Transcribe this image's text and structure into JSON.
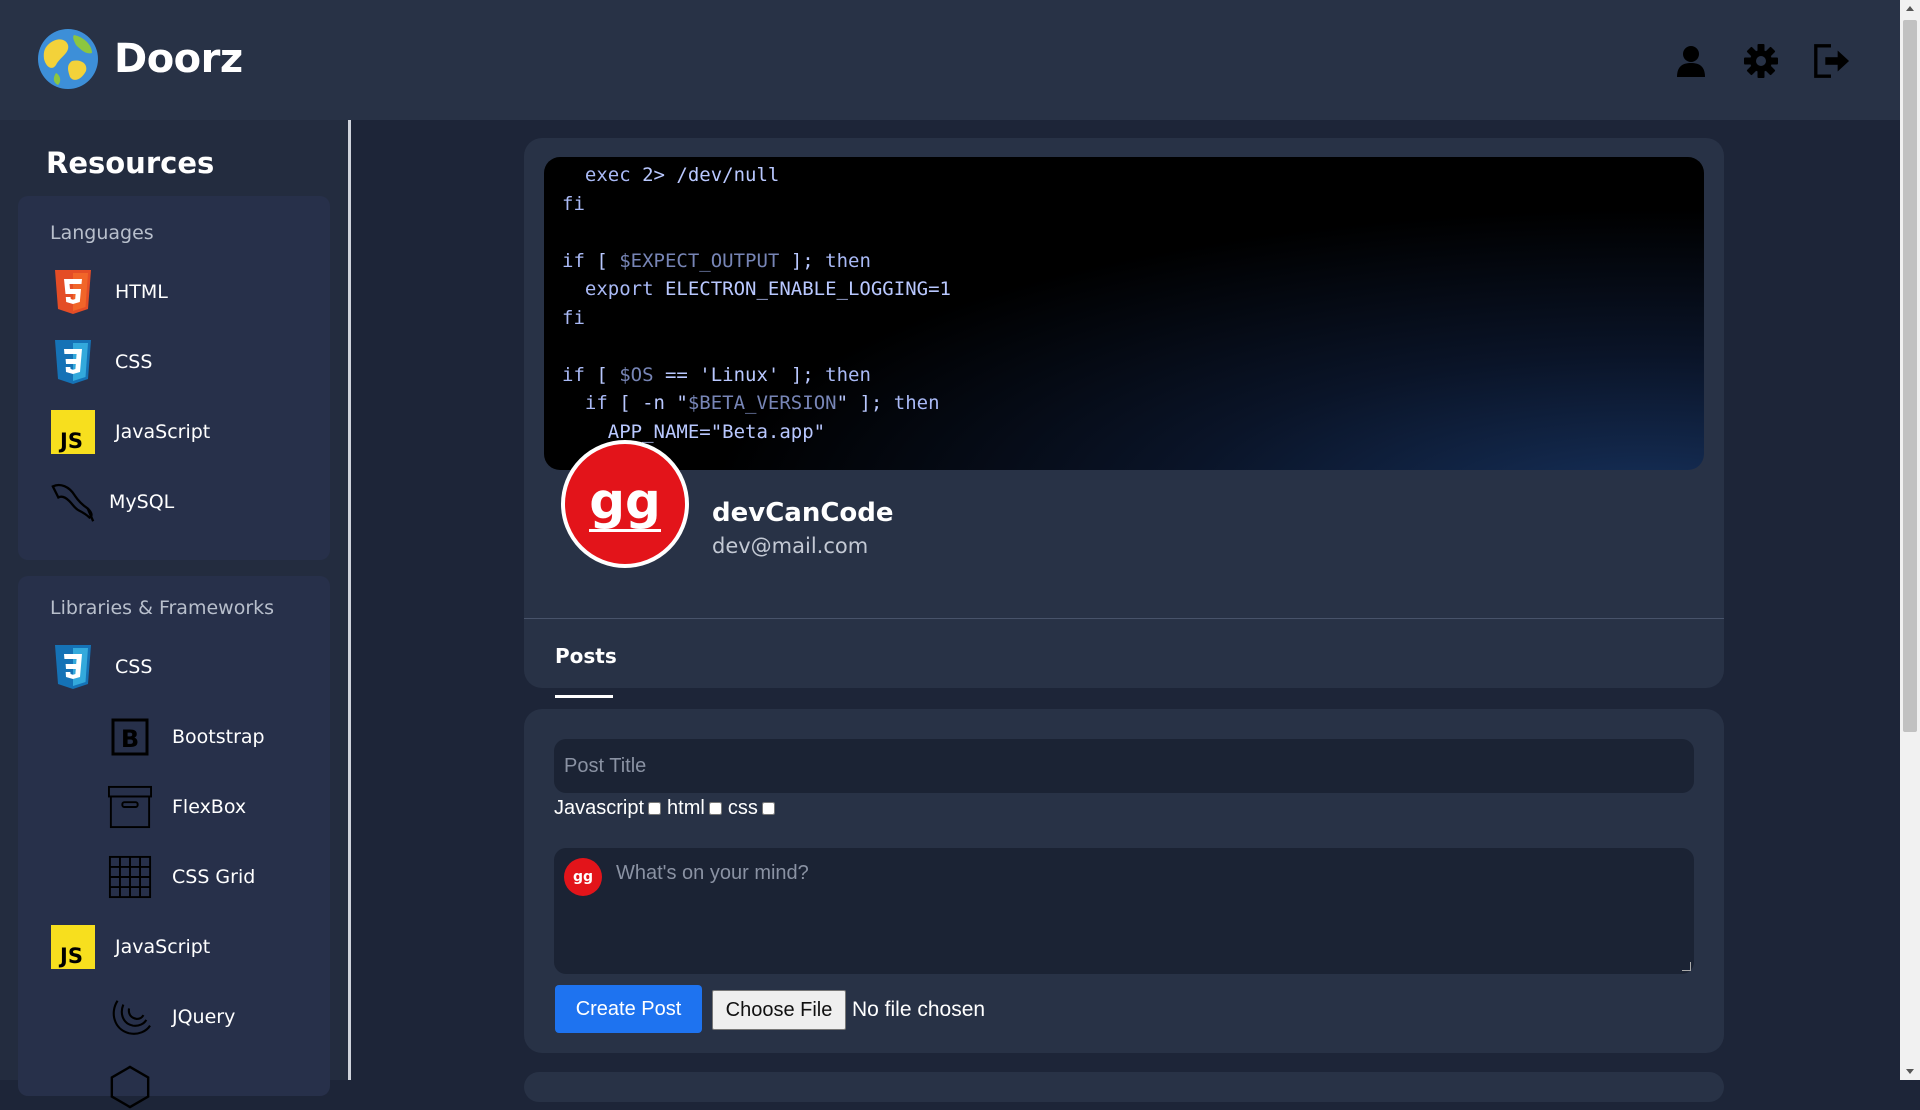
{
  "app": {
    "name": "Doorz"
  },
  "header": {
    "icons": [
      "user-icon",
      "gear-icon",
      "sign-out-icon"
    ]
  },
  "sidebar": {
    "title": "Resources",
    "sections": [
      {
        "label": "Languages",
        "items": [
          {
            "label": "HTML",
            "icon": "html5-icon"
          },
          {
            "label": "CSS",
            "icon": "css3-icon"
          },
          {
            "label": "JavaScript",
            "icon": "js-icon"
          },
          {
            "label": "MySQL",
            "icon": "mysql-dolphin-icon"
          }
        ]
      },
      {
        "label": "Libraries & Frameworks",
        "items": [
          {
            "label": "CSS",
            "icon": "css3-icon"
          },
          {
            "label": "Bootstrap",
            "icon": "bootstrap-icon"
          },
          {
            "label": "FlexBox",
            "icon": "archive-box-icon"
          },
          {
            "label": "CSS Grid",
            "icon": "grid-icon"
          },
          {
            "label": "JavaScript",
            "icon": "js-icon"
          },
          {
            "label": "JQuery",
            "icon": "jquery-icon"
          }
        ]
      }
    ]
  },
  "profile": {
    "banner_code": [
      "  exec 2> /dev/null",
      "fi",
      "",
      "if [ $EXPECT_OUTPUT ]; then",
      "  export ELECTRON_ENABLE_LOGGING=1",
      "fi",
      "",
      "if [ $OS == 'Linux' ]; then",
      "  if [ -n \"$BETA_VERSION\" ]; then",
      "    APP_NAME=\"Beta.app\""
    ],
    "avatar_text": "gg",
    "username": "devCanCode",
    "email": "dev@mail.com",
    "tabs": [
      "Posts"
    ]
  },
  "composer": {
    "title_placeholder": "Post Title",
    "tags": [
      "Javascript",
      "html",
      "css"
    ],
    "body_placeholder": "What's on your mind?",
    "create_button": "Create Post",
    "file_button": "Choose File",
    "file_status": "No file chosen"
  },
  "colors": {
    "accent": "#1e73f0",
    "avatar": "#e3141a",
    "background": "#1d2538",
    "card": "#283246"
  }
}
